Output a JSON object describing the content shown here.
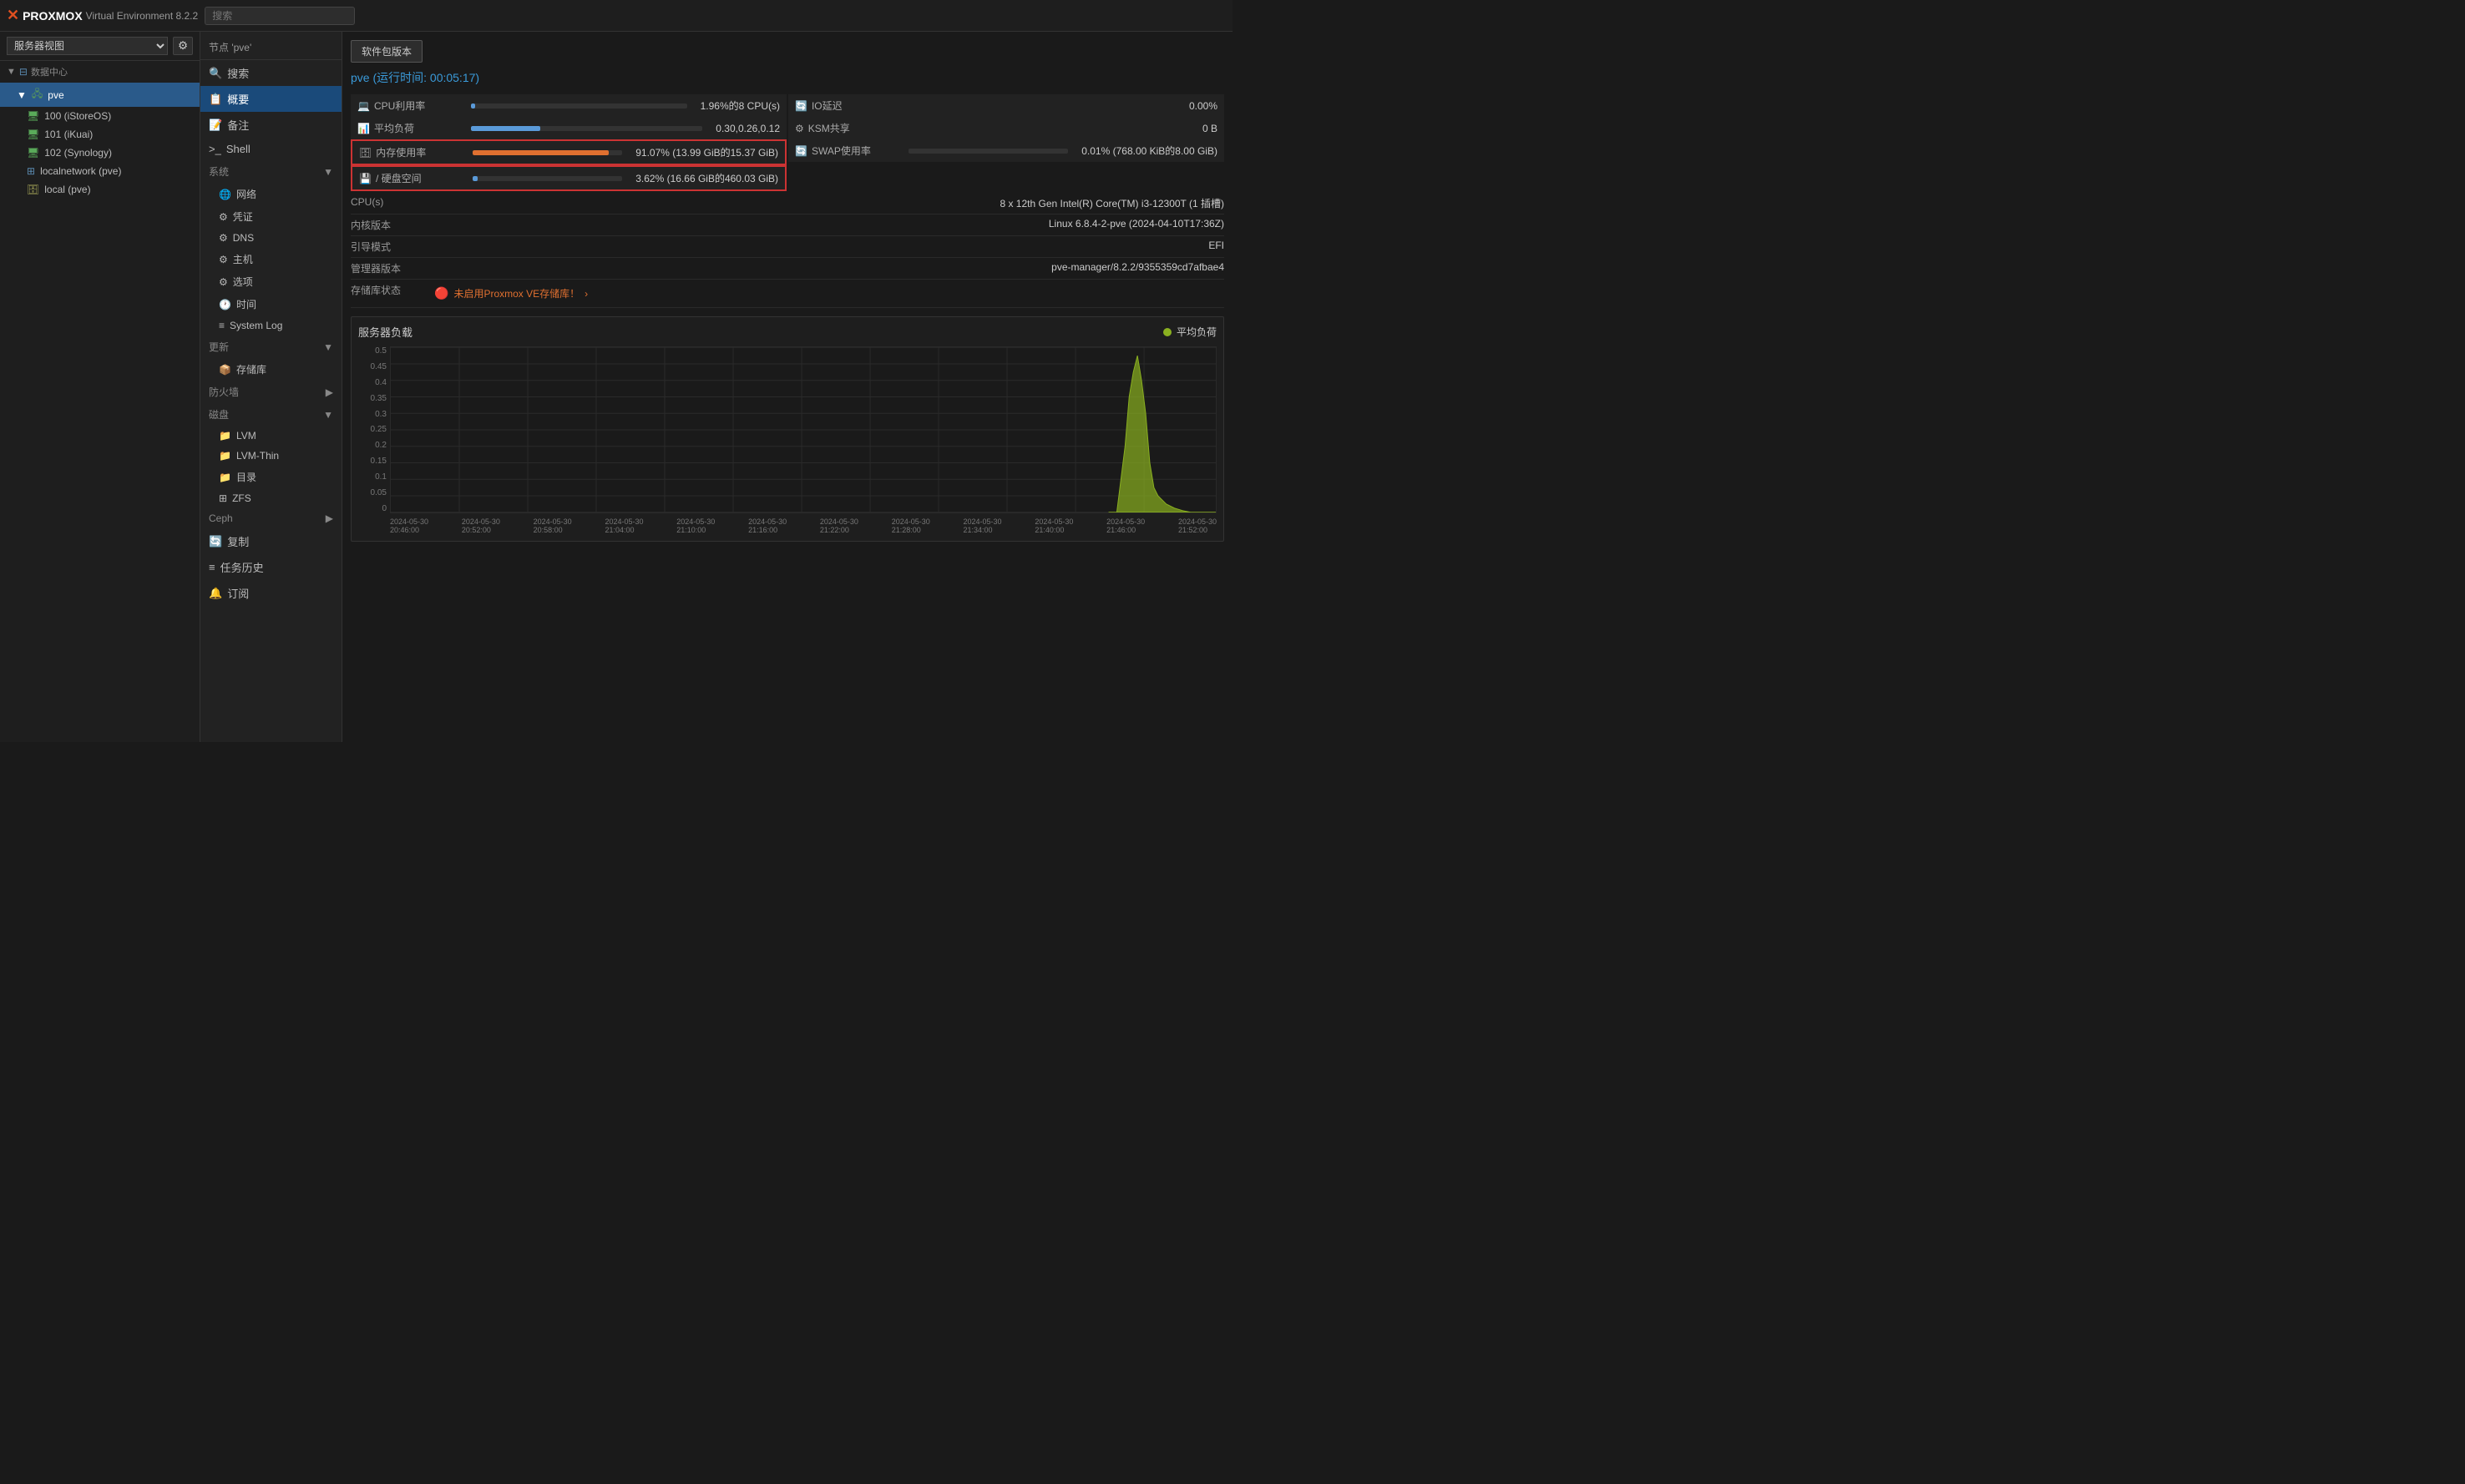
{
  "topbar": {
    "logo_x": "✕",
    "logo_name": "PROXMOX",
    "logo_ve": "Virtual Environment 8.2.2",
    "search_placeholder": "搜索"
  },
  "sidebar": {
    "view_label": "服务器视图",
    "datacenter_label": "数据中心",
    "node_label": "pve",
    "vms": [
      {
        "id": "100",
        "name": "iStoreOS",
        "icon": "🖥"
      },
      {
        "id": "101",
        "name": "iKuai",
        "icon": "🖥"
      },
      {
        "id": "102",
        "name": "Synology",
        "icon": "🖥"
      }
    ],
    "network_label": "localnetwork (pve)",
    "storage_label": "local (pve)"
  },
  "nav": {
    "breadcrumb": "节点 'pve'",
    "items": [
      {
        "id": "search",
        "label": "搜索",
        "icon": "🔍"
      },
      {
        "id": "summary",
        "label": "概要",
        "icon": "📋",
        "active": true
      },
      {
        "id": "notes",
        "label": "备注",
        "icon": "📝"
      },
      {
        "id": "shell",
        "label": "Shell",
        "icon": ">_"
      }
    ],
    "sections": [
      {
        "id": "system",
        "label": "系统",
        "items": [
          {
            "id": "network",
            "label": "网络",
            "icon": "🌐"
          },
          {
            "id": "cert",
            "label": "凭证",
            "icon": "⚙"
          },
          {
            "id": "dns",
            "label": "DNS",
            "icon": "⚙"
          },
          {
            "id": "host",
            "label": "主机",
            "icon": "⚙"
          },
          {
            "id": "options",
            "label": "选项",
            "icon": "⚙"
          },
          {
            "id": "time",
            "label": "时间",
            "icon": "🕐"
          },
          {
            "id": "syslog",
            "label": "System Log",
            "icon": "≡"
          }
        ]
      },
      {
        "id": "update",
        "label": "更新",
        "items": [
          {
            "id": "storage",
            "label": "存储库",
            "icon": "📦"
          }
        ]
      },
      {
        "id": "firewall",
        "label": "防火墙",
        "items": []
      },
      {
        "id": "disk",
        "label": "磁盘",
        "items": [
          {
            "id": "lvm",
            "label": "LVM",
            "icon": "📁"
          },
          {
            "id": "lvm-thin",
            "label": "LVM-Thin",
            "icon": "📁"
          },
          {
            "id": "dir",
            "label": "目录",
            "icon": "📁"
          },
          {
            "id": "zfs",
            "label": "ZFS",
            "icon": "⊞"
          }
        ]
      },
      {
        "id": "ceph",
        "label": "Ceph",
        "items": []
      },
      {
        "id": "replicate",
        "label": "复制",
        "items": []
      },
      {
        "id": "task-history",
        "label": "任务历史",
        "items": []
      },
      {
        "id": "subscribe",
        "label": "订阅",
        "items": []
      }
    ]
  },
  "main": {
    "toolbar": {
      "packages_btn": "软件包版本"
    },
    "page_title": "pve (运行时间: 00:05:17)",
    "cpu_label": "CPU利用率",
    "cpu_value": "1.96%的8 CPU(s)",
    "cpu_percent": 1.96,
    "load_label": "平均负荷",
    "load_value": "0.30,0.26,0.12",
    "mem_label": "内存使用率",
    "mem_value": "91.07% (13.99 GiB的15.37 GiB)",
    "mem_percent": 91.07,
    "disk_label": "/ 硬盘空间",
    "disk_value": "3.62% (16.66 GiB的460.03 GiB)",
    "disk_percent": 3.62,
    "io_label": "IO延迟",
    "io_value": "0.00%",
    "ksm_label": "KSM共享",
    "ksm_value": "0 B",
    "swap_label": "SWAP使用率",
    "swap_value": "0.01% (768.00 KiB的8.00 GiB)",
    "sys_info": [
      {
        "key": "CPU(s)",
        "value": "8 x 12th Gen Intel(R) Core(TM) i3-12300T (1 插槽)"
      },
      {
        "key": "内核版本",
        "value": "Linux 6.8.4-2-pve (2024-04-10T17:36Z)"
      },
      {
        "key": "引导模式",
        "value": "EFI"
      },
      {
        "key": "管理器版本",
        "value": "pve-manager/8.2.2/9355359cd7afbae4"
      },
      {
        "key": "存储库状态",
        "value": "warn"
      }
    ],
    "repo_warn": "未启用Proxmox VE存储库！",
    "chart": {
      "title": "服务器负载",
      "legend_label": "平均负荷",
      "y_labels": [
        "0.5",
        "0.45",
        "0.4",
        "0.35",
        "0.3",
        "0.25",
        "0.2",
        "0.15",
        "0.1",
        "0.05",
        "0"
      ],
      "x_labels": [
        "2024-05-30\n20:46:00",
        "2024-05-30\n20:52:00",
        "2024-05-30\n20:58:00",
        "2024-05-30\n21:04:00",
        "2024-05-30\n21:10:00",
        "2024-05-30\n21:16:00",
        "2024-05-30\n21:22:00",
        "2024-05-30\n21:28:00",
        "2024-05-30\n21:34:00",
        "2024-05-30\n21:40:00",
        "2024-05-30\n21:46:00",
        "2024-05-30\n21:52:00"
      ]
    }
  }
}
